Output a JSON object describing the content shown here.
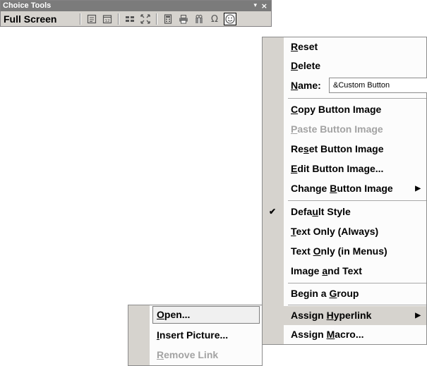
{
  "toolbar": {
    "title": "Choice Tools",
    "dropdown_glyph": "▾",
    "close_glyph": "×",
    "fullscreen_label": "Full Screen",
    "omega_glyph": "Ω",
    "buttons": [
      "page-setup-icon",
      "calendar-icon",
      "grid-icon",
      "expand-icon",
      "calculator-icon",
      "printer-icon",
      "gift-icon",
      "omega-icon",
      "smiley-icon"
    ]
  },
  "context_menu": {
    "items": {
      "reset": "Reset",
      "delete": "Delete",
      "name_label": "Name:",
      "name_value": "&Custom Button",
      "copy_image": "Copy Button Image",
      "paste_image": "Paste Button Image",
      "reset_image": "Reset Button Image",
      "edit_image": "Edit Button Image...",
      "change_image": "Change Button Image",
      "default_style": "Default Style",
      "text_only_always": "Text Only (Always)",
      "text_only_menus": "Text Only (in Menus)",
      "image_and_text": "Image and Text",
      "begin_group": "Begin a Group",
      "assign_hyperlink": "Assign Hyperlink",
      "assign_macro": "Assign Macro..."
    },
    "checked_item": "Default Style",
    "submenu_arrow": "▶",
    "check_glyph": "✔"
  },
  "hyperlink_submenu": {
    "open": "Open...",
    "insert_picture": "Insert Picture...",
    "remove_link": "Remove Link"
  },
  "colors": {
    "titlebar": "#7b7b7b",
    "menu_bg": "#fcfcfc",
    "gutter": "#d6d3ce",
    "disabled_text": "#a3a3a3"
  }
}
